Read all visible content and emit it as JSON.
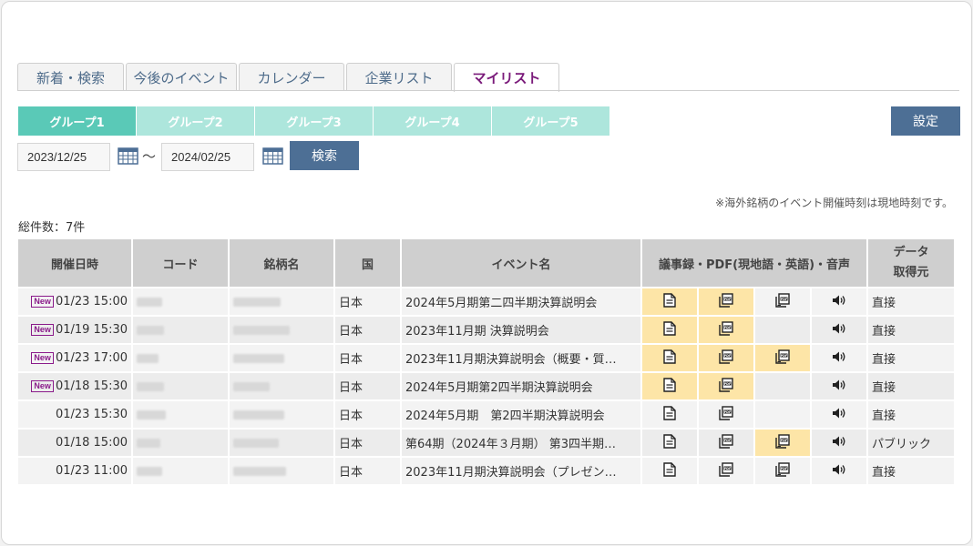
{
  "tabs": [
    {
      "label": "新着・検索",
      "active": false
    },
    {
      "label": "今後のイベント",
      "active": false
    },
    {
      "label": "カレンダー",
      "active": false
    },
    {
      "label": "企業リスト",
      "active": false
    },
    {
      "label": "マイリスト",
      "active": true
    }
  ],
  "groups": [
    {
      "label": "グループ1",
      "active": true
    },
    {
      "label": "グループ2",
      "active": false
    },
    {
      "label": "グループ3",
      "active": false
    },
    {
      "label": "グループ4",
      "active": false
    },
    {
      "label": "グループ5",
      "active": false
    }
  ],
  "settings_label": "設定",
  "filter": {
    "date_from": "2023/12/25",
    "tilde": "～",
    "date_to": "2024/02/25",
    "search_label": "検索"
  },
  "note": "※海外銘柄のイベント開催時刻は現地時刻です。",
  "total": "総件数：7件",
  "table": {
    "headers": {
      "date": "開催日時",
      "code": "コード",
      "name": "銘柄名",
      "country": "国",
      "event": "イベント名",
      "docs": "議事録・PDF(現地語・英語)・音声",
      "source_line1": "データ",
      "source_line2": "取得元"
    },
    "new_label": "New",
    "rows": [
      {
        "new": true,
        "date": "01/23 15:00",
        "country": "日本",
        "event": "2024年5月期第二四半期決算説明会",
        "source": "直接",
        "icons": [
          "doc",
          "pdf",
          "pdf-en",
          "audio"
        ],
        "hl": [
          true,
          true,
          false,
          false
        ]
      },
      {
        "new": true,
        "date": "01/19 15:30",
        "country": "日本",
        "event": "2023年11月期 決算説明会",
        "source": "直接",
        "icons": [
          "doc",
          "pdf",
          "",
          "audio"
        ],
        "hl": [
          true,
          true,
          false,
          false
        ]
      },
      {
        "new": true,
        "date": "01/23 17:00",
        "country": "日本",
        "event": "2023年11月期決算説明会（概要・質…",
        "source": "直接",
        "icons": [
          "doc",
          "pdf",
          "pdf-en",
          "audio"
        ],
        "hl": [
          true,
          true,
          true,
          false
        ]
      },
      {
        "new": true,
        "date": "01/18 15:30",
        "country": "日本",
        "event": "2024年5月期第2四半期決算説明会",
        "source": "直接",
        "icons": [
          "doc",
          "pdf",
          "",
          "audio"
        ],
        "hl": [
          true,
          true,
          false,
          false
        ]
      },
      {
        "new": false,
        "date": "01/23 15:30",
        "country": "日本",
        "event": "2024年5月期　第2四半期決算説明会",
        "source": "直接",
        "icons": [
          "doc",
          "pdf",
          "",
          "audio"
        ],
        "hl": [
          false,
          false,
          false,
          false
        ]
      },
      {
        "new": false,
        "date": "01/18 15:00",
        "country": "日本",
        "event": "第64期（2024年３月期） 第3四半期…",
        "source": "パブリック",
        "icons": [
          "doc",
          "pdf",
          "pdf-en",
          "audio"
        ],
        "hl": [
          false,
          false,
          true,
          false
        ]
      },
      {
        "new": false,
        "date": "01/23 11:00",
        "country": "日本",
        "event": "2023年11月期決算説明会（プレゼン…",
        "source": "直接",
        "icons": [
          "doc",
          "pdf",
          "pdf-en",
          "audio"
        ],
        "hl": [
          false,
          false,
          false,
          false
        ]
      }
    ]
  },
  "icon_names": {
    "doc": "document-icon",
    "pdf": "pdf-icon",
    "pdf-en": "pdf-english-icon",
    "audio": "audio-icon",
    "calendar": "calendar-icon"
  },
  "colors": {
    "accent": "#5ac9b7",
    "group_inactive": "#ade6dc",
    "button": "#4d6f95",
    "highlight": "#fde5a7",
    "active_tab_text": "#7a1a7a"
  }
}
